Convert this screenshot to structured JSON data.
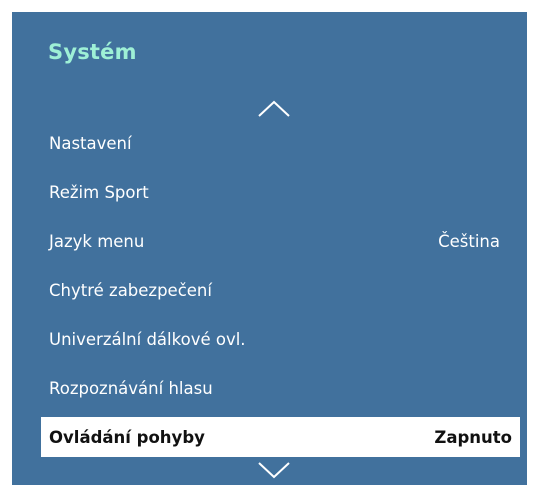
{
  "header": {
    "title": "Systém"
  },
  "nav": {
    "up_icon": "chevron-up-icon",
    "down_icon": "chevron-down-icon"
  },
  "menu": {
    "items": [
      {
        "label": "Nastavení",
        "value": ""
      },
      {
        "label": "Režim Sport",
        "value": ""
      },
      {
        "label": "Jazyk menu",
        "value": "Čeština"
      },
      {
        "label": "Chytré zabezpečení",
        "value": ""
      },
      {
        "label": "Univerzální dálkové ovl.",
        "value": ""
      },
      {
        "label": "Rozpoznávání hlasu",
        "value": ""
      },
      {
        "label": "Ovládání pohyby",
        "value": "Zapnuto",
        "selected": true
      }
    ]
  },
  "colors": {
    "panel_background": "#41719d",
    "title": "#9ef0d6",
    "item_text": "#ffffff",
    "selected_background": "#ffffff",
    "selected_text": "#111111"
  }
}
